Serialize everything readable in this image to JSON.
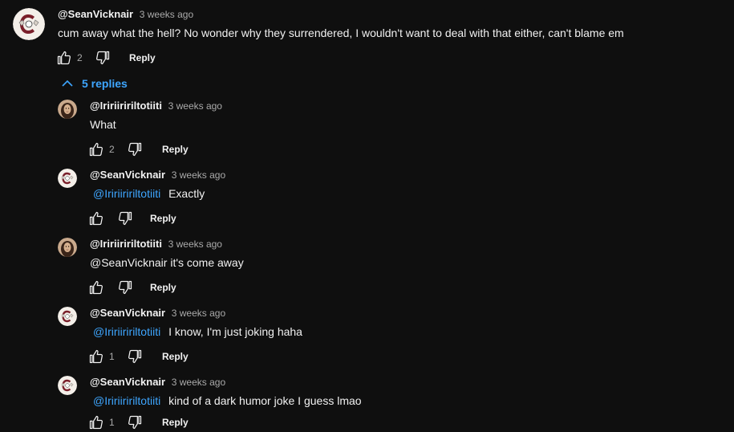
{
  "top_comment": {
    "author": "@SeanVicknair",
    "time": "3 weeks ago",
    "text": "cum away what the hell? No wonder why they surrendered, I wouldn't want to deal with that either, can't blame em",
    "likes": "2",
    "reply_label": "Reply"
  },
  "replies_toggle": {
    "label": "5 replies"
  },
  "replies": [
    {
      "author": "@Iririiririltotiiti",
      "time": "3 weeks ago",
      "mention": "",
      "text": "What",
      "likes": "2",
      "reply_label": "Reply"
    },
    {
      "author": "@SeanVicknair",
      "time": "3 weeks ago",
      "mention": "@Iririiririltotiiti",
      "text": "Exactly",
      "likes": "",
      "reply_label": "Reply"
    },
    {
      "author": "@Iririiririltotiiti",
      "time": "3 weeks ago",
      "mention": "",
      "text": "@SeanVicknair it's come away",
      "likes": "",
      "reply_label": "Reply"
    },
    {
      "author": "@SeanVicknair",
      "time": "3 weeks ago",
      "mention": "@Iririiririltotiiti",
      "text": "I know, I'm just joking haha",
      "likes": "1",
      "reply_label": "Reply"
    },
    {
      "author": "@SeanVicknair",
      "time": "3 weeks ago",
      "mention": "@Iririiririltotiiti",
      "text": "kind of a dark humor joke I guess lmao",
      "likes": "1",
      "reply_label": "Reply"
    }
  ]
}
